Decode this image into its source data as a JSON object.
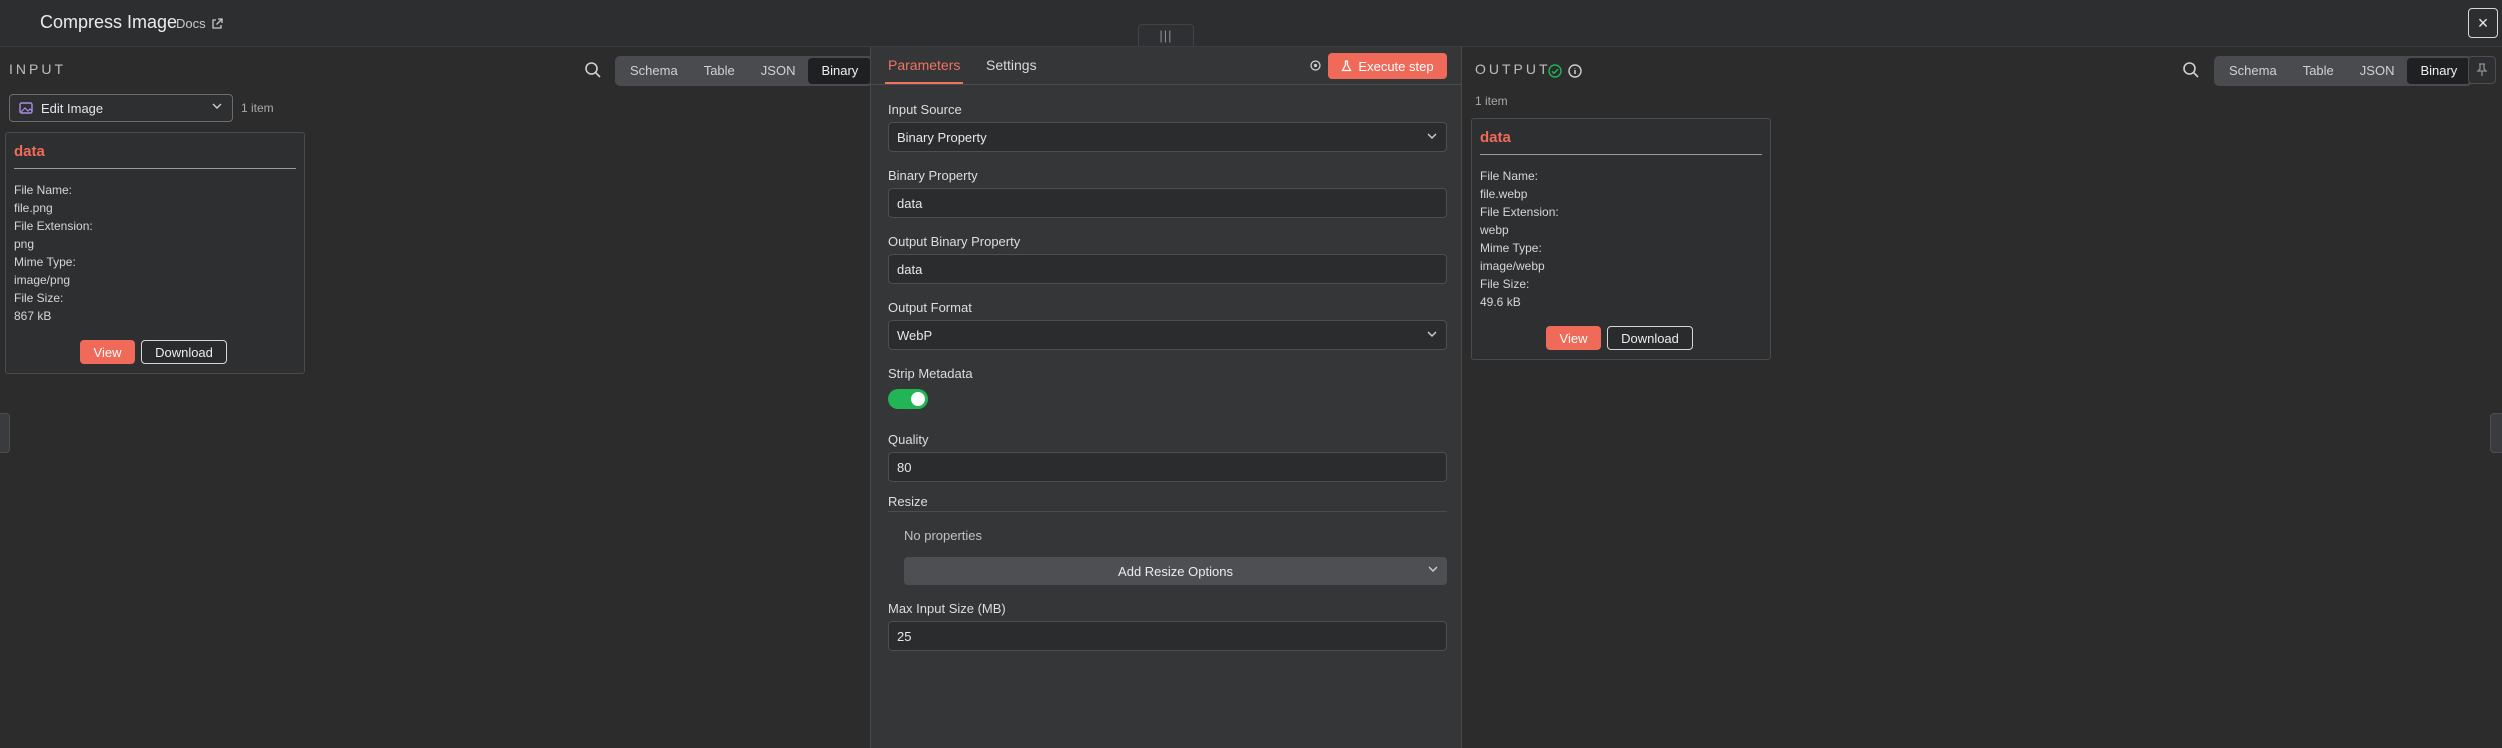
{
  "header": {
    "title": "Compress Image",
    "docs_label": "Docs",
    "drag_handle_glyph": "|||",
    "close_glyph": "×"
  },
  "input": {
    "label": "INPUT",
    "view_tabs": [
      "Schema",
      "Table",
      "JSON",
      "Binary"
    ],
    "active_view": "Binary",
    "node_select_value": "Edit Image",
    "item_count": "1 item",
    "card": {
      "title": "data",
      "lines": [
        "File Name:",
        "file.png",
        "File Extension:",
        "png",
        "Mime Type:",
        "image/png",
        "File Size:",
        "867 kB"
      ],
      "view_label": "View",
      "download_label": "Download"
    }
  },
  "params": {
    "tabs": {
      "parameters": "Parameters",
      "settings": "Settings"
    },
    "execute_label": "Execute step",
    "fields": {
      "input_source": {
        "label": "Input Source",
        "value": "Binary Property"
      },
      "binary_property": {
        "label": "Binary Property",
        "value": "data"
      },
      "output_binary_property": {
        "label": "Output Binary Property",
        "value": "data"
      },
      "output_format": {
        "label": "Output Format",
        "value": "WebP"
      },
      "strip_metadata": {
        "label": "Strip Metadata",
        "enabled": true
      },
      "quality": {
        "label": "Quality",
        "value": "80"
      },
      "max_input_size": {
        "label": "Max Input Size (MB)",
        "value": "25"
      }
    },
    "resize": {
      "label": "Resize",
      "empty_text": "No properties",
      "add_label": "Add Resize Options"
    }
  },
  "output": {
    "label": "OUTPUT",
    "view_tabs": [
      "Schema",
      "Table",
      "JSON",
      "Binary"
    ],
    "active_view": "Binary",
    "item_count": "1 item",
    "card": {
      "title": "data",
      "lines": [
        "File Name:",
        "file.webp",
        "File Extension:",
        "webp",
        "Mime Type:",
        "image/webp",
        "File Size:",
        "49.6 kB"
      ],
      "view_label": "View",
      "download_label": "Download"
    }
  },
  "colors": {
    "accent": "#ef6a58",
    "success": "#21b555",
    "panel_bg": "#2c2c2d",
    "params_bg": "#353638"
  },
  "icons": [
    "search-icon",
    "external-link-icon",
    "image-node-icon",
    "chevron-down-icon",
    "gear-icon",
    "flask-icon",
    "success-check-icon",
    "info-icon",
    "pin-icon",
    "close-icon"
  ]
}
